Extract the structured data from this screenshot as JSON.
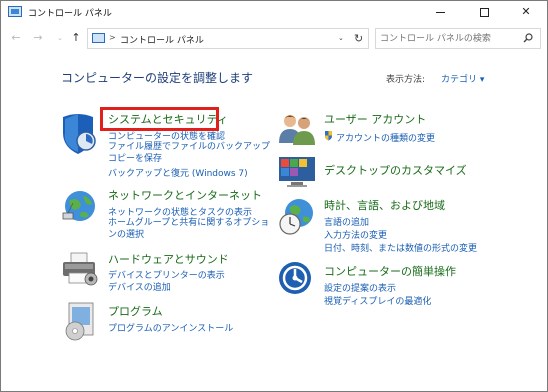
{
  "window": {
    "title": "コントロール パネル",
    "minimize": "",
    "maximize": "",
    "close": "✕"
  },
  "nav": {
    "back": "←",
    "forward": "→",
    "recent": "⌄",
    "up": "↑",
    "breadcrumb_sep": ">",
    "address": "コントロール パネル",
    "address_dropdown": "⌄",
    "refresh": "↻",
    "search_placeholder": "コントロール パネルの検索"
  },
  "main": {
    "title": "コンピューターの設定を調整します",
    "view_label": "表示方法:",
    "view_value": "カテゴリ ▾"
  },
  "categories": [
    {
      "title": "システムとセキュリティ",
      "links": [
        "コンピューターの状態を確認",
        "ファイル履歴でファイルのバックアップ コピーを保存",
        "バックアップと復元 (Windows 7)"
      ]
    },
    {
      "title": "ネットワークとインターネット",
      "links": [
        "ネットワークの状態とタスクの表示",
        "ホームグループと共有に関するオプションの選択"
      ]
    },
    {
      "title": "ハードウェアとサウンド",
      "links": [
        "デバイスとプリンターの表示",
        "デバイスの追加"
      ]
    },
    {
      "title": "プログラム",
      "links": [
        "プログラムのアンインストール"
      ]
    },
    {
      "title": "ユーザー アカウント",
      "links": [
        "アカウントの種類の変更"
      ]
    },
    {
      "title": "デスクトップのカスタマイズ",
      "links": []
    },
    {
      "title": "時計、言語、および地域",
      "links": [
        "言語の追加",
        "入力方法の変更",
        "日付、時刻、または数値の形式の変更"
      ]
    },
    {
      "title": "コンピューターの簡単操作",
      "links": [
        "設定の提案の表示",
        "視覚ディスプレイの最適化"
      ]
    }
  ],
  "colors": {
    "category_title": "#176b17",
    "link": "#1a5fb4",
    "highlight": "#e0201b"
  }
}
